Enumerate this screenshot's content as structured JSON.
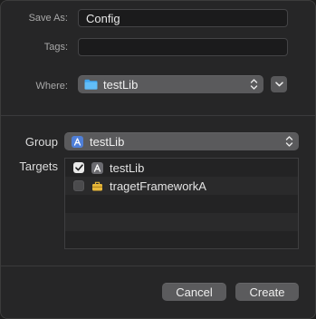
{
  "form": {
    "save_as_label": "Save As:",
    "save_as_value": "Config",
    "tags_label": "Tags:",
    "tags_value": "",
    "where_label": "Where:",
    "where_value": "testLib",
    "where_icon": "folder-icon",
    "expand_icon": "chevron-down-icon"
  },
  "group": {
    "label": "Group",
    "value": "testLib",
    "icon": "app-target-icon"
  },
  "targets": {
    "label": "Targets",
    "items": [
      {
        "label": "testLib",
        "checked": true,
        "icon": "app-target-icon"
      },
      {
        "label": "tragetFrameworkA",
        "checked": false,
        "icon": "framework-toolbox-icon"
      }
    ]
  },
  "buttons": {
    "cancel": "Cancel",
    "create": "Create"
  },
  "colors": {
    "background": "#262627",
    "folder_blue": "#3fa6f0",
    "framework_yellow": "#e8b83a",
    "app_icon_blue": "#4f7fd8"
  }
}
